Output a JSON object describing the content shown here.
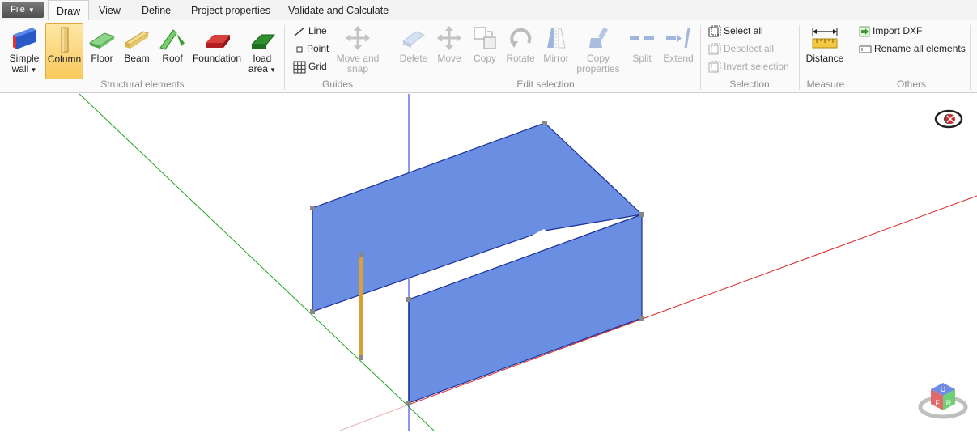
{
  "file_menu": {
    "label": "File"
  },
  "tabs": [
    {
      "label": "Draw"
    },
    {
      "label": "View"
    },
    {
      "label": "Define"
    },
    {
      "label": "Project properties"
    },
    {
      "label": "Validate and Calculate"
    }
  ],
  "structural": {
    "group_label": "Structural elements",
    "simple_wall": {
      "line1": "Simple",
      "line2": "wall"
    },
    "column": "Column",
    "floor": "Floor",
    "beam": "Beam",
    "roof": "Roof",
    "foundation": "Foundation",
    "load_area": {
      "line1": "load",
      "line2": "area"
    }
  },
  "guides": {
    "group_label": "Guides",
    "line": "Line",
    "point": "Point",
    "grid": "Grid",
    "move_snap": {
      "line1": "Move and",
      "line2": "snap"
    }
  },
  "edit": {
    "group_label": "Edit selection",
    "delete": "Delete",
    "move": "Move",
    "copy": "Copy",
    "rotate": "Rotate",
    "mirror": "Mirror",
    "copy_properties": {
      "line1": "Copy",
      "line2": "properties"
    },
    "split": "Split",
    "extend": "Extend"
  },
  "selection": {
    "group_label": "Selection",
    "select_all": "Select all",
    "deselect_all": "Deselect all",
    "invert_selection": "Invert selection"
  },
  "measure": {
    "group_label": "Measure",
    "distance": "Distance"
  },
  "others": {
    "group_label": "Others",
    "import_dxf": "Import DXF",
    "rename_all": "Rename all elements"
  },
  "viewcube": {
    "top": "U",
    "left": "F",
    "right": "R"
  },
  "colors": {
    "wall_fill": "#6a8fe2",
    "wall_edge": "#1a2f9a",
    "column": "#d9a036",
    "x_axis": "#dd2222",
    "y_axis": "#1ea51e",
    "z_axis": "#1b2fd6"
  }
}
